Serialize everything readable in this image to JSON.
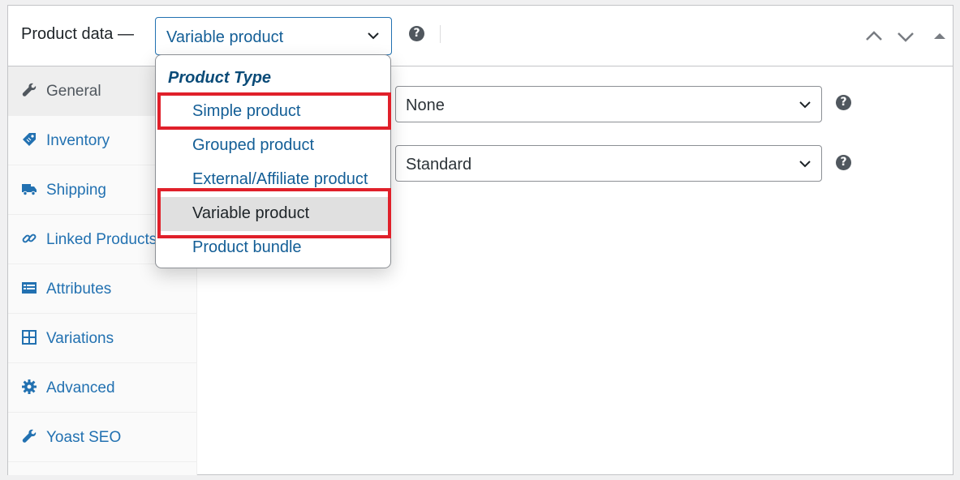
{
  "header": {
    "title": "Product data —",
    "product_type_value": "Variable product"
  },
  "sidebar": {
    "tabs": [
      {
        "label": "General",
        "icon": "wrench-icon",
        "active": true
      },
      {
        "label": "Inventory",
        "icon": "tag-icon"
      },
      {
        "label": "Shipping",
        "icon": "truck-icon"
      },
      {
        "label": "Linked Products",
        "icon": "link-icon"
      },
      {
        "label": "Attributes",
        "icon": "list-view-icon"
      },
      {
        "label": "Variations",
        "icon": "grid-icon"
      },
      {
        "label": "Advanced",
        "icon": "gear-icon"
      },
      {
        "label": "Yoast SEO",
        "icon": "wrench-icon"
      }
    ]
  },
  "main": {
    "field1_value": "None",
    "field2_value": "Standard"
  },
  "dropdown": {
    "group_label": "Product Type",
    "options": [
      {
        "label": "Simple product",
        "highlighted": true
      },
      {
        "label": "Grouped product"
      },
      {
        "label": "External/Affiliate product"
      },
      {
        "label": "Variable product",
        "selected": true,
        "highlighted": true
      },
      {
        "label": "Product bundle"
      }
    ]
  },
  "colors": {
    "link": "#2271b1",
    "highlight_border": "#e0202a",
    "selected_option_bg": "#e0e0e0"
  }
}
